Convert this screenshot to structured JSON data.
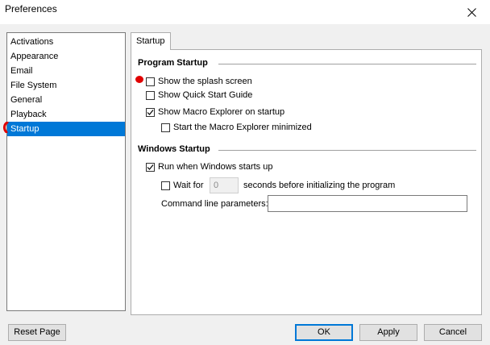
{
  "window": {
    "title": "Preferences"
  },
  "nav": {
    "items": [
      {
        "label": "Activations"
      },
      {
        "label": "Appearance"
      },
      {
        "label": "Email"
      },
      {
        "label": "File System"
      },
      {
        "label": "General"
      },
      {
        "label": "Playback"
      },
      {
        "label": "Startup",
        "selected": true
      }
    ]
  },
  "tab": {
    "label": "Startup"
  },
  "program_startup": {
    "title": "Program Startup",
    "show_splash": {
      "label": "Show the splash screen",
      "checked": false
    },
    "show_quick_start": {
      "label": "Show Quick Start Guide",
      "checked": false
    },
    "show_macro_explorer": {
      "label": "Show Macro Explorer on startup",
      "checked": true
    },
    "start_minimized": {
      "label": "Start the Macro Explorer minimized",
      "checked": false
    }
  },
  "windows_startup": {
    "title": "Windows Startup",
    "run_on_start": {
      "label": "Run when Windows starts up",
      "checked": true
    },
    "wait_for": {
      "label": "Wait for",
      "checked": false,
      "value": "0",
      "suffix": "seconds before initializing the program"
    },
    "command_line": {
      "label": "Command line parameters:",
      "value": ""
    }
  },
  "buttons": {
    "reset": "Reset Page",
    "ok": "OK",
    "apply": "Apply",
    "cancel": "Cancel"
  },
  "colors": {
    "selection": "#0078d7",
    "annotation": "#e00000"
  }
}
